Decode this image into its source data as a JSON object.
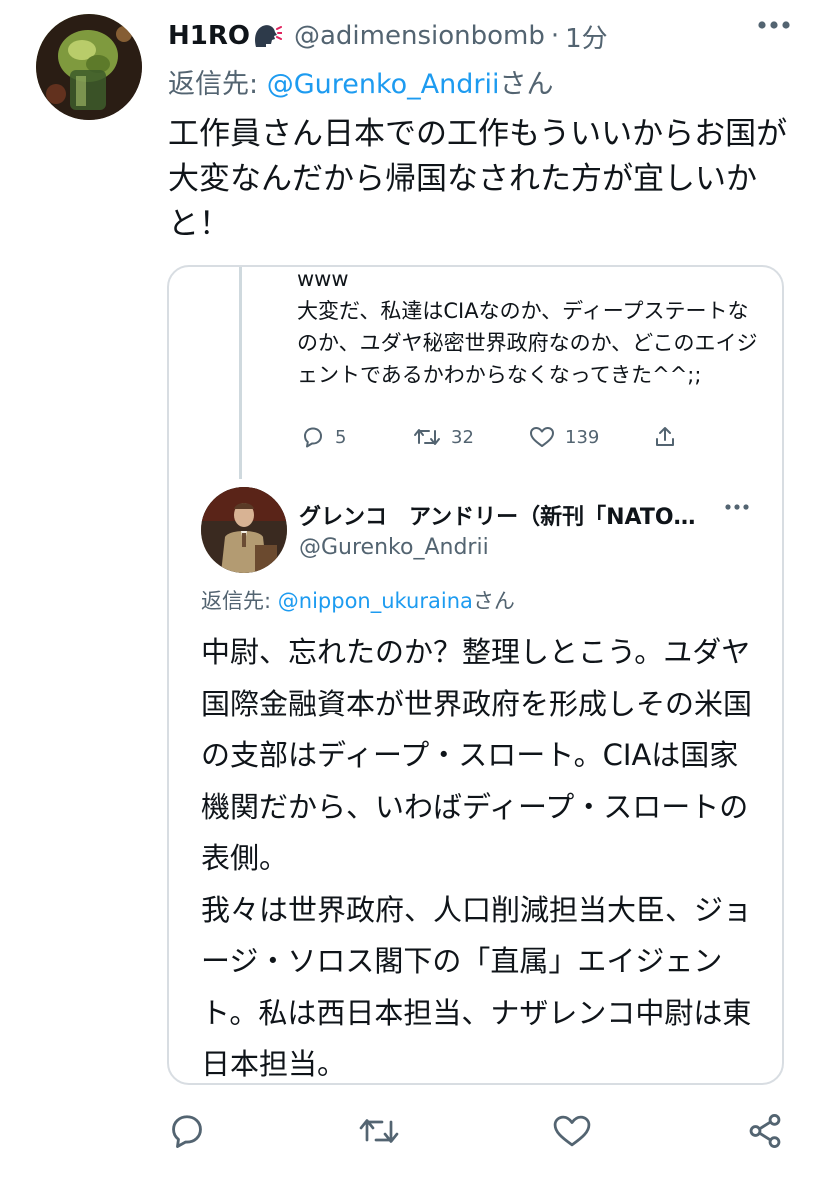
{
  "tweet": {
    "display_name": "H1RO",
    "name_emoji": "speaking-head-icon",
    "handle": "@adimensionbomb",
    "separator": "·",
    "time": "1分",
    "reply_prefix": "返信先: ",
    "reply_mention": "@Gurenko_Andrii",
    "reply_suffix": "さん",
    "text": "工作員さん日本での工作もういいからお国が大変なんだから帰国なされた方が宜しいかと！"
  },
  "quote": {
    "previous_text": "www\n大変だ、私達はCIAなのか、ディープステートなのか、ユダヤ秘密世界政府なのか、どこのエイジェントであるかわからなくなってきた^^;;",
    "previous_actions": {
      "replies": "5",
      "retweets": "32",
      "likes": "139"
    },
    "author_name": "グレンコ　アンドリー（新刊「NATO…",
    "author_handle": "@Gurenko_Andrii",
    "reply_prefix": "返信先: ",
    "reply_mention": "@nippon_ukuraina",
    "reply_suffix": "さん",
    "text": "中尉、忘れたのか？整理しとこう。ユダヤ国際金融資本が世界政府を形成しその米国の支部はディープ・スロート。CIAは国家機関だから、いわばディープ・スロートの表側。\n我々は世界政府、人口削減担当大臣、ジョージ・ソロス閣下の「直属」エイジェント。私は西日本担当、ナザレンコ中尉は東日本担当。"
  },
  "icons": {
    "more": "more-icon",
    "reply": "reply-icon",
    "retweet": "retweet-icon",
    "like": "like-icon",
    "share": "share-icon"
  },
  "colors": {
    "text": "#0f1419",
    "secondary": "#536471",
    "link": "#1d9bf0",
    "border": "#d8dde2"
  }
}
